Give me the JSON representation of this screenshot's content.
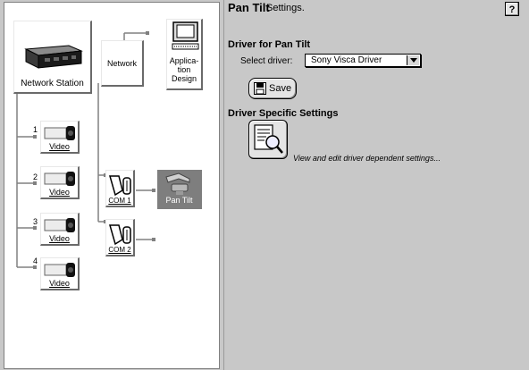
{
  "tree": {
    "network_station": {
      "label": "Network Station"
    },
    "network": {
      "label": "Network"
    },
    "application_design": {
      "label": "Application Design",
      "line1": "Applica-",
      "line2": "tion",
      "line3": "Design"
    },
    "videos": [
      {
        "number": "1",
        "label": "Video"
      },
      {
        "number": "2",
        "label": "Video"
      },
      {
        "number": "3",
        "label": "Video"
      },
      {
        "number": "4",
        "label": "Video"
      }
    ],
    "com_ports": [
      {
        "label": "COM 1"
      },
      {
        "label": "COM 2"
      }
    ],
    "pan_tilt": {
      "label": "Pan Tilt",
      "selected": true
    }
  },
  "settings": {
    "title": "Pan Tilt",
    "title_suffix": "Settings.",
    "help_label": "?",
    "driver_section": "Driver for Pan Tilt",
    "select_driver_label": "Select driver:",
    "selected_driver": "Sony Visca Driver",
    "save_label": "Save",
    "specific_section": "Driver Specific Settings",
    "specific_description": "View and edit driver dependent settings..."
  },
  "colors": {
    "background": "#c8c8c8",
    "tree_background": "#ffffff",
    "selected_node": "#7e7e7e"
  }
}
